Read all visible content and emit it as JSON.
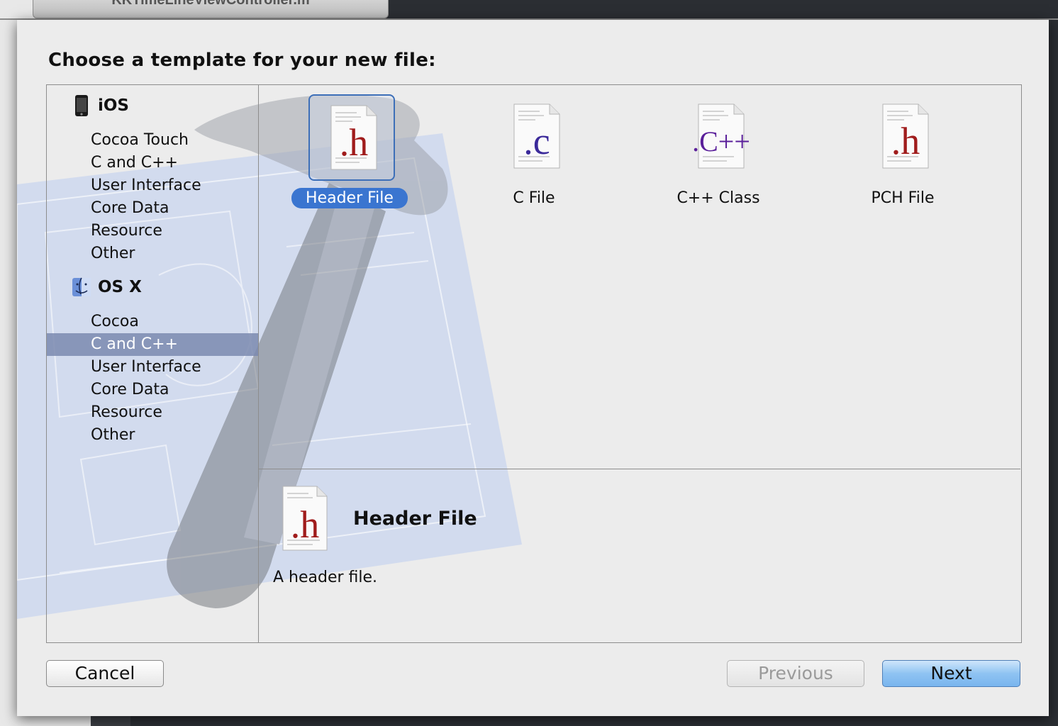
{
  "window": {
    "background_tab_title": "KKTimeLineViewController.m"
  },
  "dialog": {
    "title": "Choose a template for your new file:"
  },
  "sidebar": {
    "groups": [
      {
        "name": "iOS",
        "icon": "iphone-icon",
        "items": [
          "Cocoa Touch",
          "C and C++",
          "User Interface",
          "Core Data",
          "Resource",
          "Other"
        ]
      },
      {
        "name": "OS X",
        "icon": "finder-icon",
        "items": [
          "Cocoa",
          "C and C++",
          "User Interface",
          "Core Data",
          "Resource",
          "Other"
        ]
      }
    ],
    "selected": "OS X / C and C++"
  },
  "templates": [
    {
      "label": "Header File",
      "glyph": ".h",
      "glyph_color": "#a01c1c",
      "selected": true
    },
    {
      "label": "C File",
      "glyph": ".c",
      "glyph_color": "#3b2a9a",
      "selected": false
    },
    {
      "label": "C++ Class",
      "glyph": ".C++",
      "glyph_color": "#5a1f9a",
      "selected": false
    },
    {
      "label": "PCH File",
      "glyph": ".h",
      "glyph_color": "#a01c1c",
      "selected": false
    }
  ],
  "detail": {
    "title": "Header File",
    "description": "A header file."
  },
  "buttons": {
    "cancel": "Cancel",
    "previous": "Previous",
    "next": "Next"
  },
  "colors": {
    "accent": "#3a75d0",
    "sidebar_selection": "#7b8aaf",
    "header_glyph": "#a01c1c"
  }
}
